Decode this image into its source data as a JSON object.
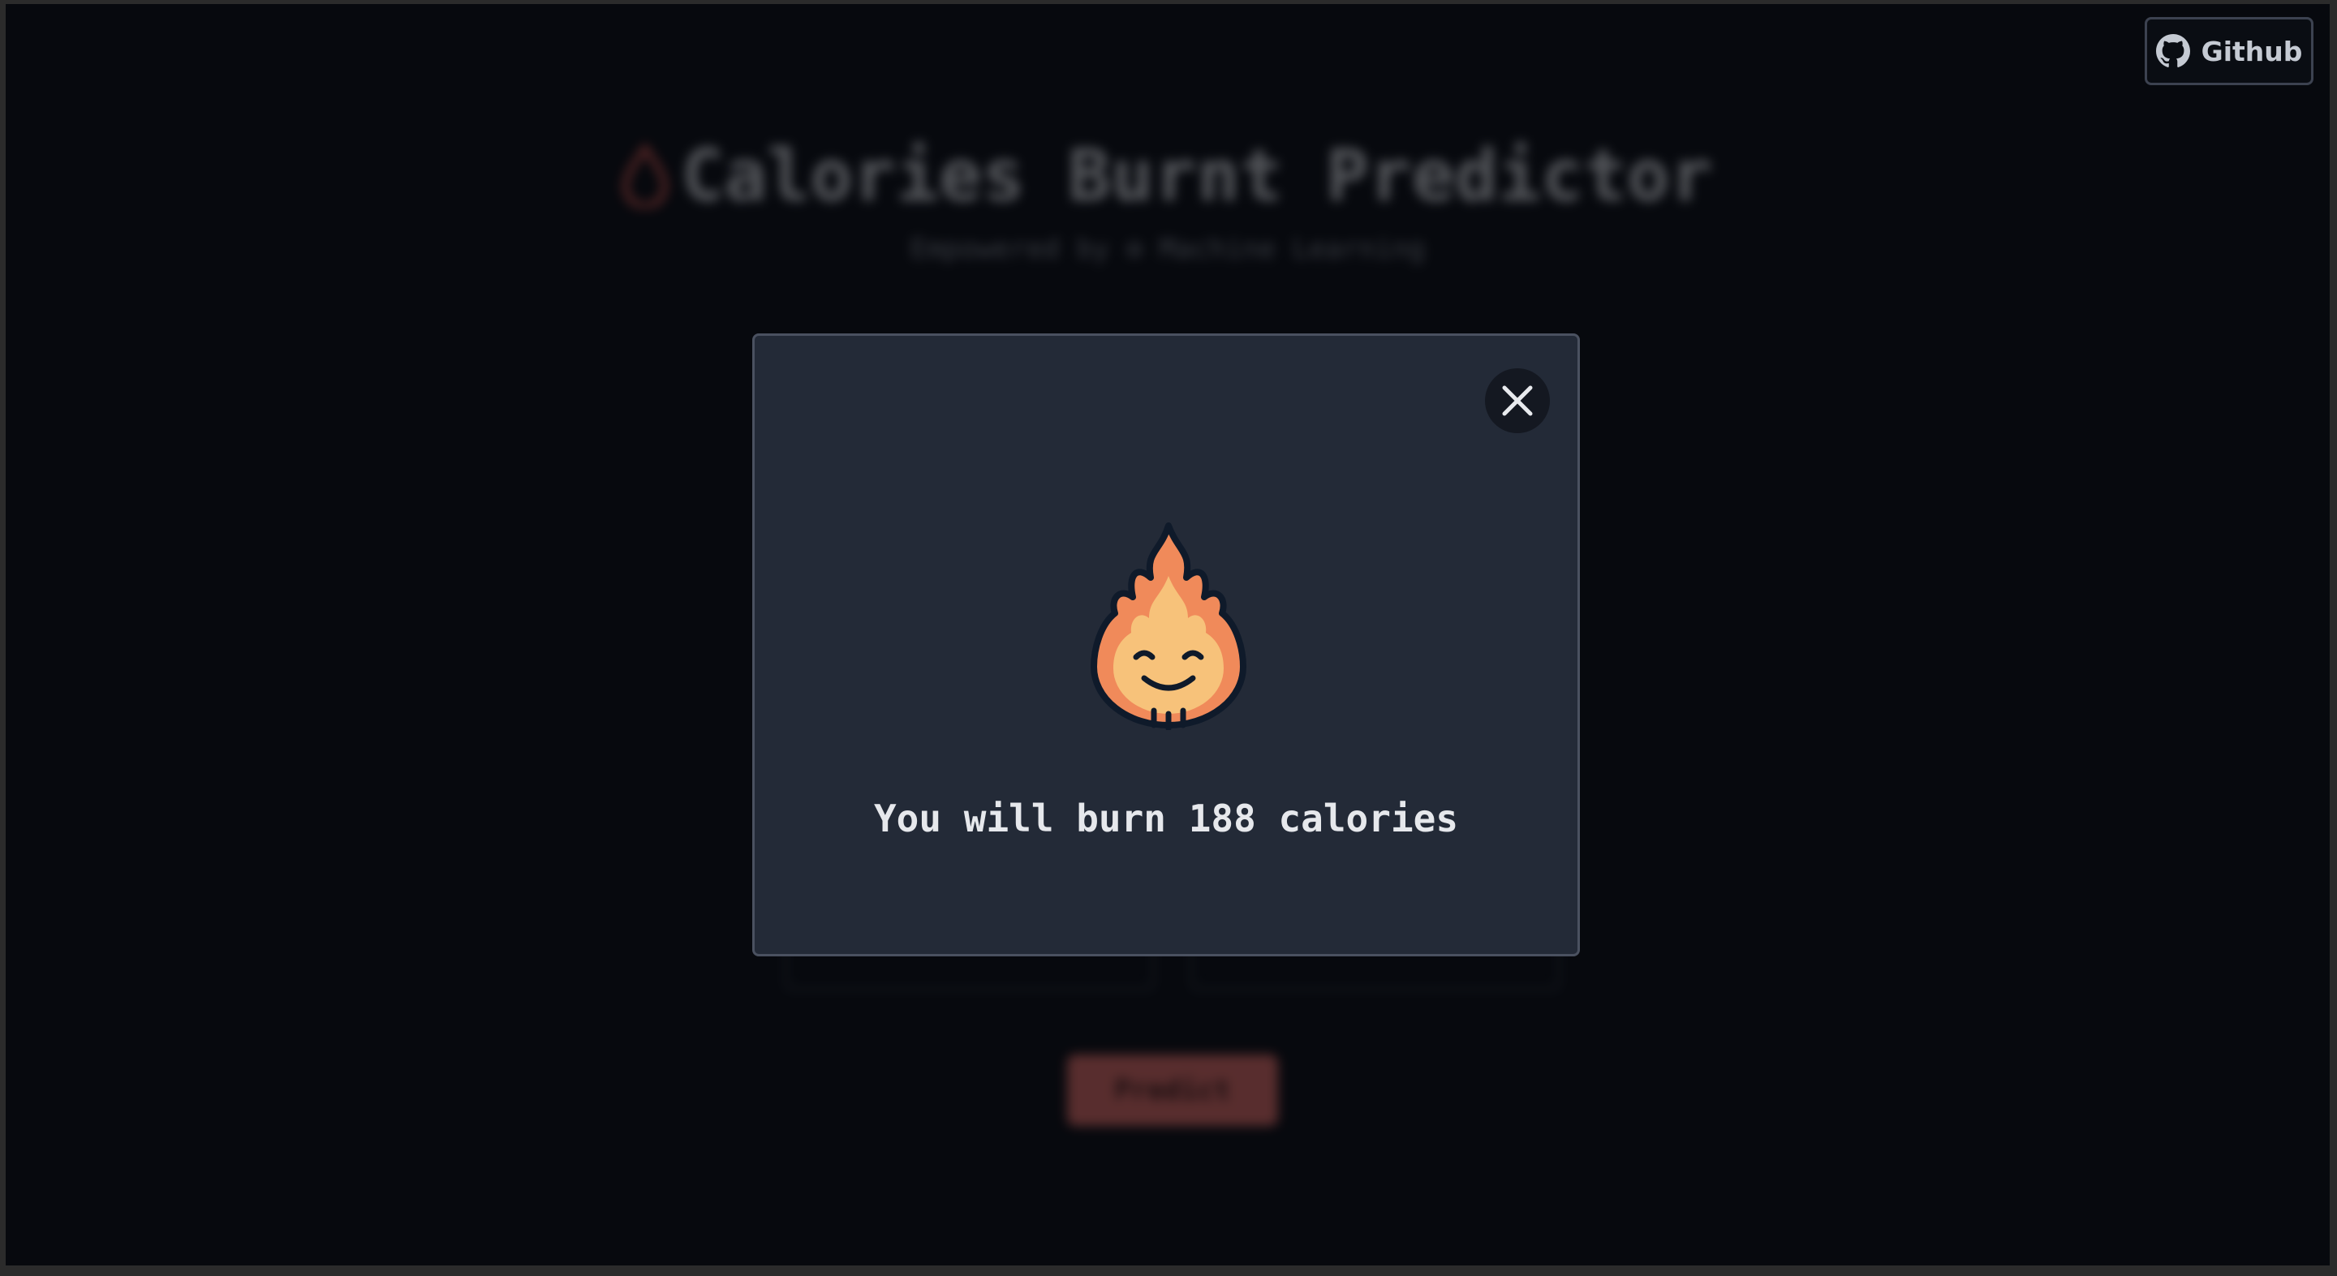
{
  "header": {
    "github_label": "Github"
  },
  "background": {
    "title": "Calories Burnt Predictor",
    "subtitle": "Empowered by ⚙ Machine Learning",
    "predict_label": "Predict"
  },
  "modal": {
    "result_text": "You will burn 188 calories",
    "icon": "smiling-flame-icon"
  },
  "colors": {
    "page_bg": "#07090e",
    "modal_bg": "#232a37",
    "accent": "#f0726a"
  }
}
